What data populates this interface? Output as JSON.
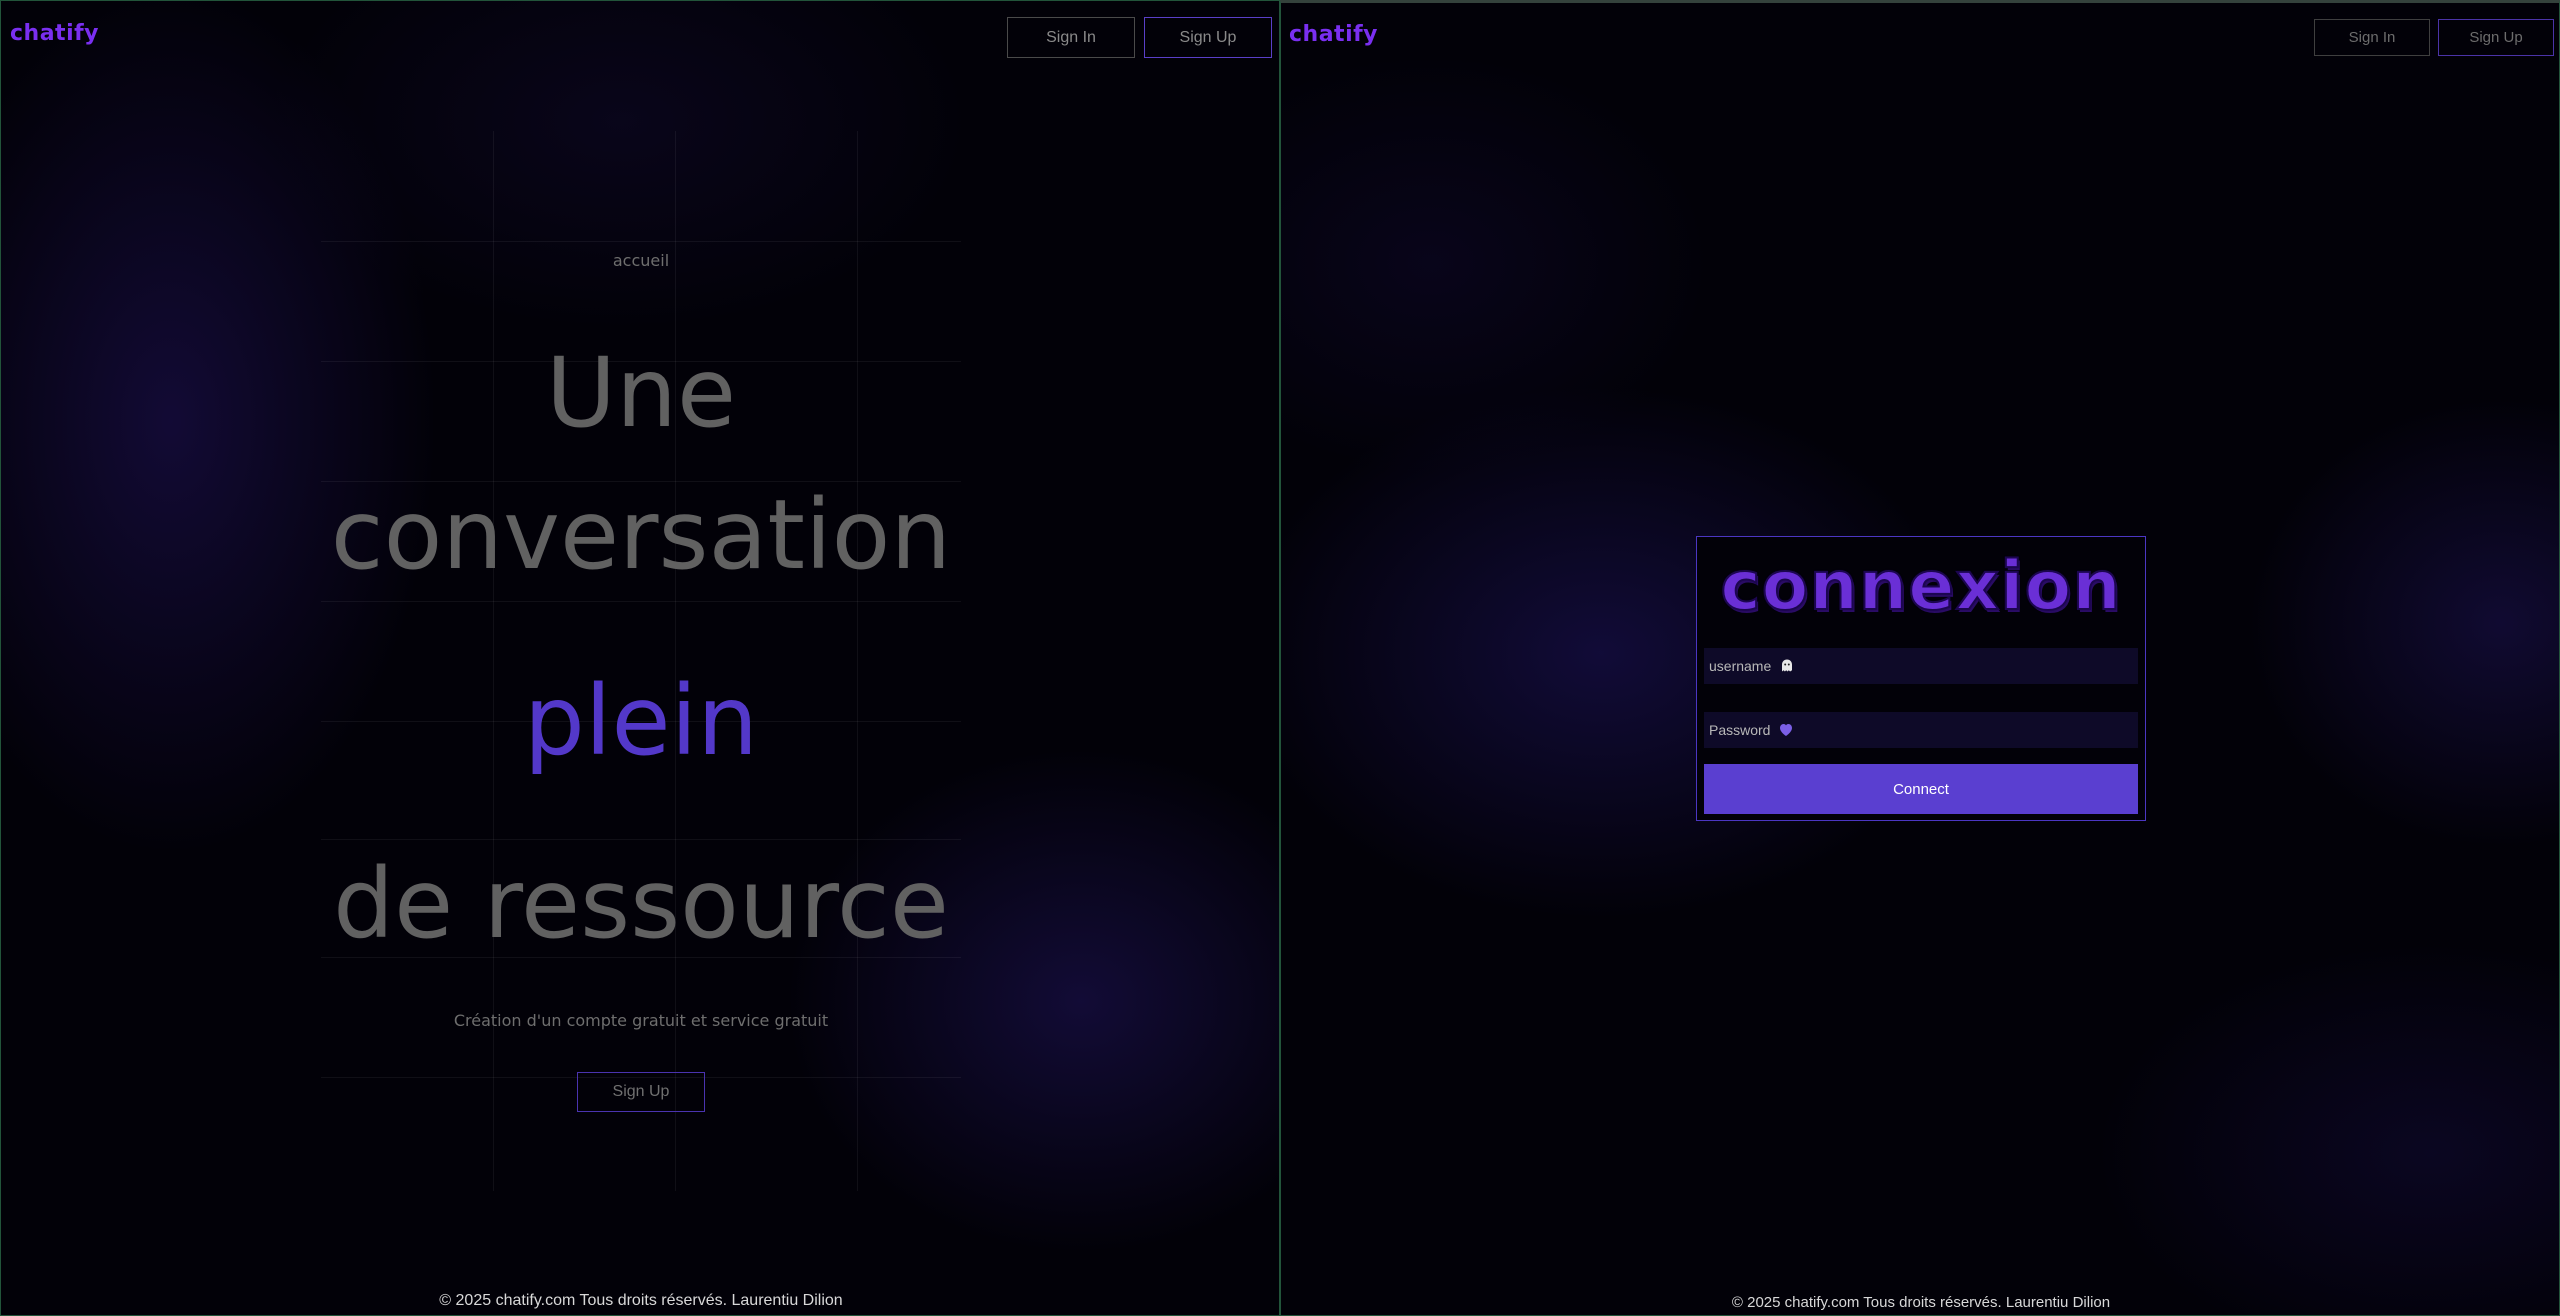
{
  "left": {
    "brand": "chatify",
    "nav": {
      "sign_in": "Sign In",
      "sign_up": "Sign Up"
    },
    "hero": {
      "eyebrow": "accueil",
      "line1": "Une",
      "line2": "conversation",
      "line3": "plein",
      "line4": "de ressource",
      "subtitle": "Création d'un compte gratuit et service gratuit",
      "cta": "Sign Up"
    },
    "footer": "© 2025 chatify.com Tous droits réservés. Laurentiu Dilion"
  },
  "right": {
    "brand": "chatify",
    "nav": {
      "sign_in": "Sign In",
      "sign_up": "Sign Up"
    },
    "login": {
      "title": "connexion",
      "username_placeholder": "username",
      "username_icon": "ghost-icon",
      "password_placeholder": "Password",
      "password_icon": "heart-icon",
      "submit": "Connect"
    },
    "footer": "© 2025 chatify.com Tous droits réservés. Laurentiu Dilion"
  },
  "colors": {
    "accent": "#5a3fd0",
    "brand": "#7a2ff0",
    "background": "#020108"
  }
}
